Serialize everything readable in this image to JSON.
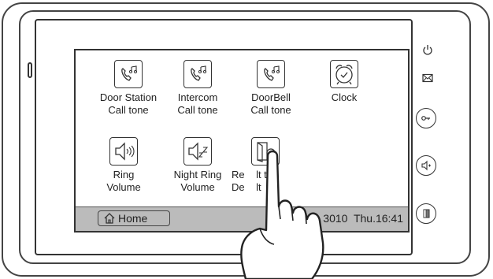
{
  "menu": {
    "items": [
      {
        "line1": "Door Station",
        "line2": "Call tone",
        "icon": "phone-note-icon"
      },
      {
        "line1": "Intercom",
        "line2": "Call tone",
        "icon": "phone-note-icon"
      },
      {
        "line1": "DoorBell",
        "line2": "Call tone",
        "icon": "phone-note-icon"
      },
      {
        "line1": "Clock",
        "line2": "",
        "icon": "alarm-clock-icon"
      },
      {
        "line1": "Ring",
        "line2": "Volume",
        "icon": "speaker-icon"
      },
      {
        "line1": "Night Ring",
        "line2": "Volume",
        "icon": "speaker-zz-icon"
      },
      {
        "line1": "Re    lt to",
        "line2": "De    lt",
        "icon": "reset-document-icon"
      }
    ]
  },
  "statusbar": {
    "home_label": "Home",
    "datetime": "0     3010  Thu.16:41"
  },
  "side_buttons": [
    {
      "icon": "power-icon"
    },
    {
      "icon": "mail-icon"
    },
    {
      "icon": "unlock-key-icon"
    },
    {
      "icon": "intercom-icon"
    },
    {
      "icon": "door-icon"
    }
  ],
  "colors": {
    "statusbar": "#bbbbbb",
    "outline": "#333333"
  }
}
